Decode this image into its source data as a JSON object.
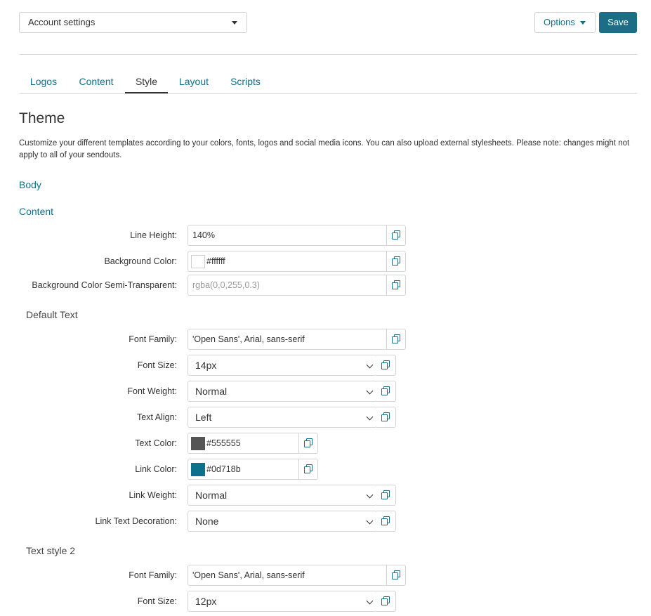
{
  "header": {
    "select_value": "Account settings",
    "options_label": "Options",
    "save_label": "Save"
  },
  "tabs": [
    "Logos",
    "Content",
    "Style",
    "Layout",
    "Scripts"
  ],
  "active_tab": "Style",
  "theme": {
    "title": "Theme",
    "description": "Customize your different templates according to your colors, fonts, logos and social media icons. You can also upload external stylesheets. Please note: changes might not apply to all of your sendouts."
  },
  "sections": {
    "body": "Body",
    "content": "Content"
  },
  "content_fields": {
    "line_height": {
      "label": "Line Height:",
      "value": "140%"
    },
    "background_color": {
      "label": "Background Color:",
      "value": "#ffffff",
      "swatch": "#ffffff"
    },
    "background_semi": {
      "label": "Background Color Semi-Transparent:",
      "placeholder": "rgba(0,0,255,0.3)"
    }
  },
  "default_text": {
    "heading": "Default Text",
    "font_family": {
      "label": "Font Family:",
      "value": "'Open Sans', Arial, sans-serif"
    },
    "font_size": {
      "label": "Font Size:",
      "value": "14px"
    },
    "font_weight": {
      "label": "Font Weight:",
      "value": "Normal"
    },
    "text_align": {
      "label": "Text Align:",
      "value": "Left"
    },
    "text_color": {
      "label": "Text Color:",
      "value": "#555555",
      "swatch": "#555555"
    },
    "link_color": {
      "label": "Link Color:",
      "value": "#0d718b",
      "swatch": "#0d718b"
    },
    "link_weight": {
      "label": "Link Weight:",
      "value": "Normal"
    },
    "link_decoration": {
      "label": "Link Text Decoration:",
      "value": "None"
    }
  },
  "text_style_2": {
    "heading": "Text style 2",
    "font_family": {
      "label": "Font Family:",
      "value": "'Open Sans', Arial, sans-serif"
    },
    "font_size": {
      "label": "Font Size:",
      "value": "12px"
    }
  },
  "colors": {
    "accent": "#0d718b",
    "save_button": "#1c6e86"
  },
  "icons": {
    "copy": "copy-icon",
    "caret": "caret-down-icon",
    "chevron": "chevron-down-icon"
  }
}
